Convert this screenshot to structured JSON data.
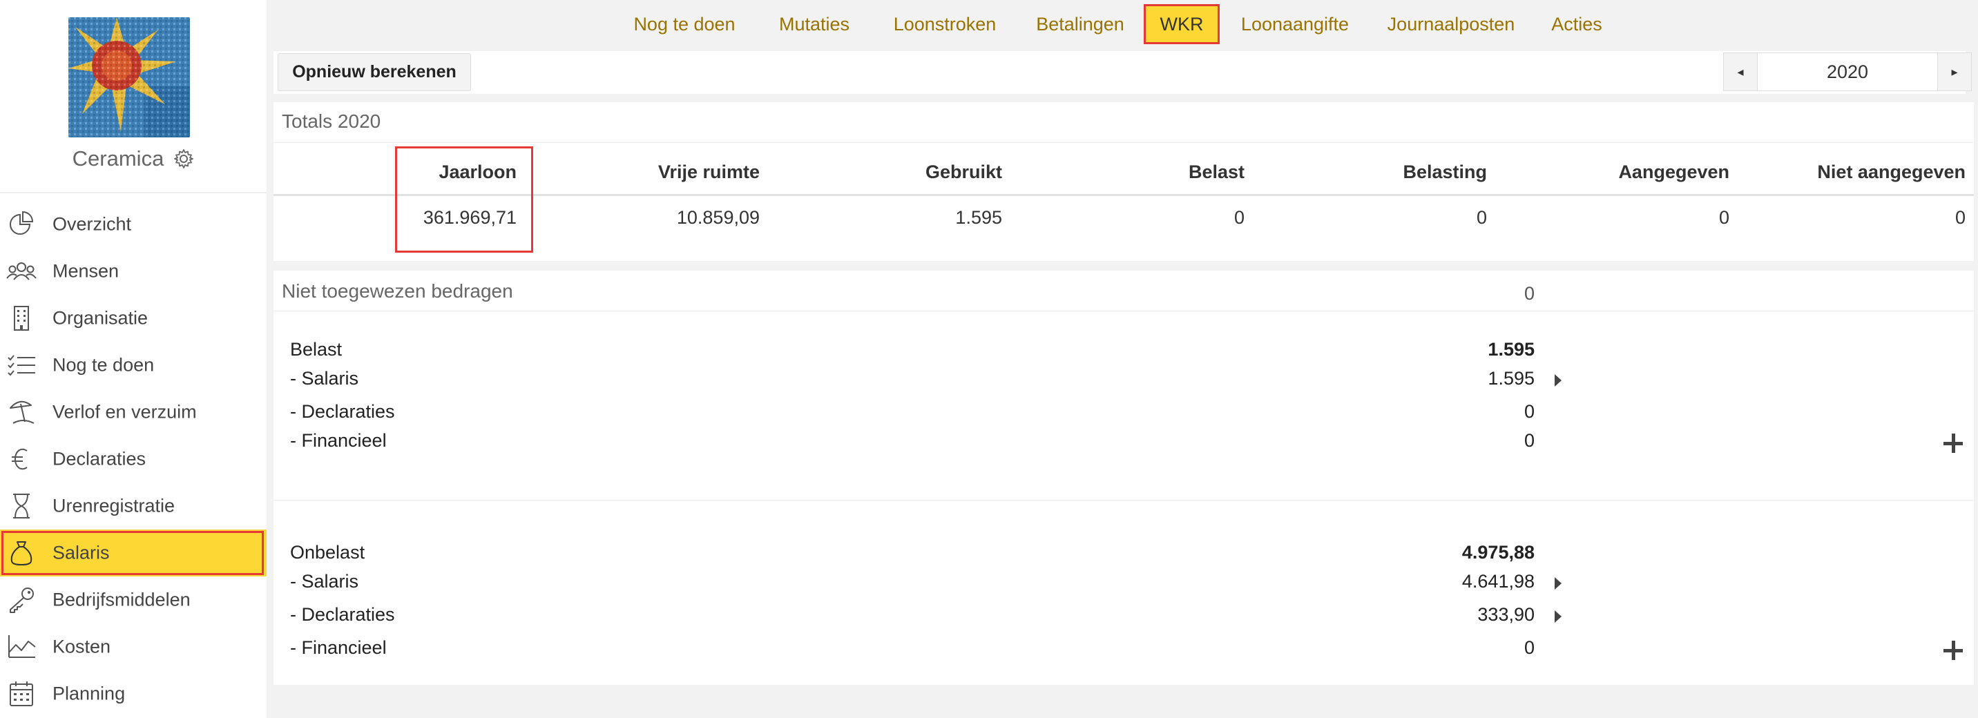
{
  "sidebar": {
    "company_name": "Ceramica",
    "items": [
      {
        "label": "Overzicht",
        "icon": "pie-chart-icon"
      },
      {
        "label": "Mensen",
        "icon": "people-icon"
      },
      {
        "label": "Organisatie",
        "icon": "building-icon"
      },
      {
        "label": "Nog te doen",
        "icon": "checklist-icon"
      },
      {
        "label": "Verlof en verzuim",
        "icon": "beach-umbrella-icon"
      },
      {
        "label": "Declaraties",
        "icon": "euro-icon"
      },
      {
        "label": "Urenregistratie",
        "icon": "hourglass-icon"
      },
      {
        "label": "Salaris",
        "icon": "money-bag-icon",
        "active": true
      },
      {
        "label": "Bedrijfsmiddelen",
        "icon": "key-icon"
      },
      {
        "label": "Kosten",
        "icon": "area-chart-icon"
      },
      {
        "label": "Planning",
        "icon": "calendar-icon"
      }
    ]
  },
  "tabs": [
    {
      "label": "Nog te doen"
    },
    {
      "label": "Mutaties"
    },
    {
      "label": "Loonstroken"
    },
    {
      "label": "Betalingen"
    },
    {
      "label": "WKR",
      "active": true
    },
    {
      "label": "Loonaangifte"
    },
    {
      "label": "Journaalposten"
    },
    {
      "label": "Acties"
    }
  ],
  "toolbar": {
    "recalc_label": "Opnieuw berekenen",
    "year": "2020",
    "prev_symbol": "◂",
    "next_symbol": "▸"
  },
  "totals": {
    "title": "Totals 2020",
    "headers": [
      "Jaarloon",
      "Vrije ruimte",
      "Gebruikt",
      "Belast",
      "Belasting",
      "Aangegeven",
      "Niet aangegeven"
    ],
    "values": [
      "361.969,71",
      "10.859,09",
      "1.595",
      "0",
      "0",
      "0",
      "0"
    ]
  },
  "unassigned": {
    "title": "Niet toegewezen bedragen",
    "value": "0",
    "belast": {
      "label": "Belast",
      "total": "1.595",
      "rows": [
        {
          "label": "- Salaris",
          "value": "1.595",
          "expandable": true
        },
        {
          "label": "- Declaraties",
          "value": "0",
          "expandable": false
        },
        {
          "label": "- Financieel",
          "value": "0",
          "expandable": false
        }
      ]
    },
    "onbelast": {
      "label": "Onbelast",
      "total": "4.975,88",
      "rows": [
        {
          "label": "- Salaris",
          "value": "4.641,98",
          "expandable": true
        },
        {
          "label": "- Declaraties",
          "value": "333,90",
          "expandable": true
        },
        {
          "label": "- Financieel",
          "value": "0",
          "expandable": false
        }
      ]
    }
  },
  "colors": {
    "accent": "#fdd835",
    "highlight_border": "#e53935",
    "tab_text": "#9a7300"
  }
}
